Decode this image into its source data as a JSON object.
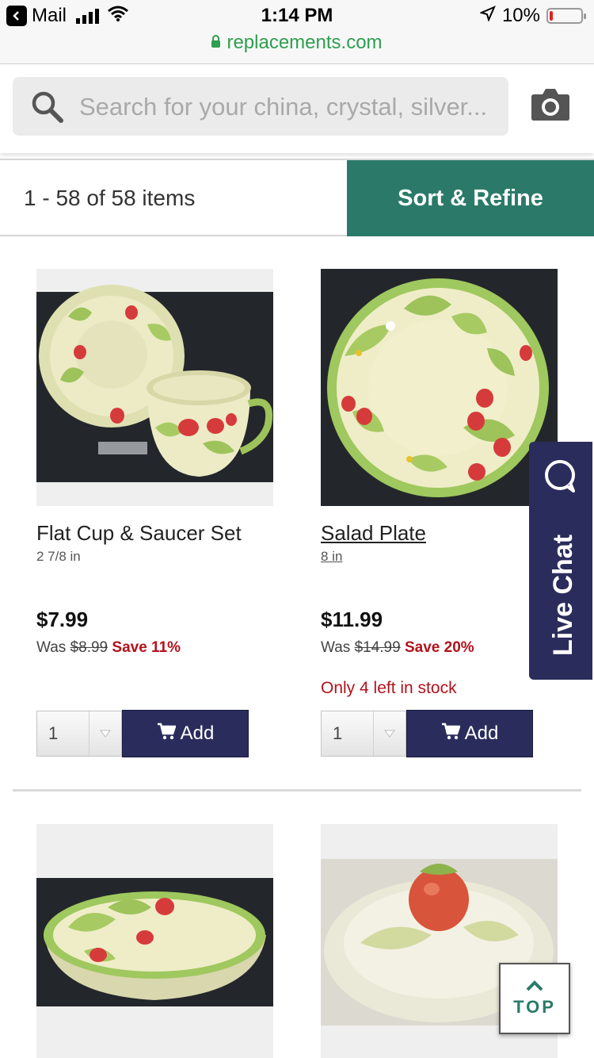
{
  "status_bar": {
    "back_app": "Mail",
    "time": "1:14 PM",
    "battery": "10%",
    "battery_level": 0.1,
    "url": "replacements.com"
  },
  "search": {
    "placeholder": "Search for your china, crystal, silver...",
    "icons": [
      "search-icon",
      "camera-icon"
    ]
  },
  "results": {
    "count": "1 - 58 of 58 items",
    "sort_label": "Sort & Refine"
  },
  "products": [
    {
      "name": "Flat Cup & Saucer Set",
      "size": "2 7/8 in",
      "price": "$7.99",
      "was_label": "Was",
      "was_price": "$8.99",
      "save": "Save 11%",
      "stock": "",
      "qty": "1",
      "add_label": "Add"
    },
    {
      "name": "Salad Plate",
      "size": "8 in",
      "price": "$11.99",
      "was_label": "Was",
      "was_price": "$14.99",
      "save": "Save 20%",
      "stock": "Only 4 left in stock",
      "qty": "1",
      "add_label": "Add"
    }
  ],
  "live_chat": {
    "label": "Live Chat"
  },
  "top_button": {
    "label": "TOP"
  },
  "colors": {
    "brand_green": "#2b7a69",
    "navy": "#2a2d5c",
    "sale_red": "#b3121b",
    "url_green": "#2e9e4f"
  }
}
